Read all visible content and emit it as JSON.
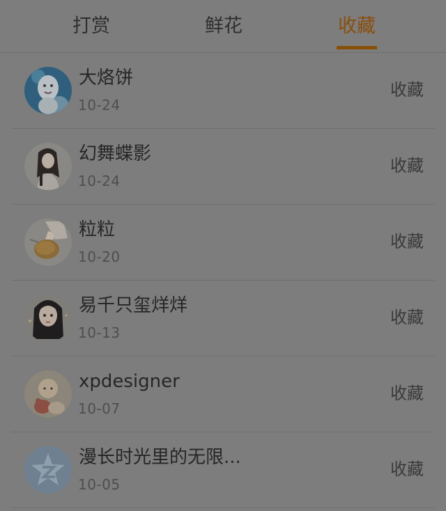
{
  "tabs": [
    {
      "label": "打赏",
      "active": false
    },
    {
      "label": "鲜花",
      "active": false
    },
    {
      "label": "收藏",
      "active": true
    }
  ],
  "colors": {
    "active_tab": "#8a4e0c",
    "overlay_bg": "#7d7d7d"
  },
  "records": [
    {
      "name": "大烙饼",
      "date": "10-24",
      "action": "收藏",
      "avatar_icon": "cartoon-character-avatar"
    },
    {
      "name": "幻舞蝶影",
      "date": "10-24",
      "action": "收藏",
      "avatar_icon": "girl-photo-avatar"
    },
    {
      "name": "粒粒",
      "date": "10-20",
      "action": "收藏",
      "avatar_icon": "bread-photo-avatar"
    },
    {
      "name": "易千只玺烊烊",
      "date": "10-13",
      "action": "收藏",
      "avatar_icon": "anime-girl-avatar"
    },
    {
      "name": "xpdesigner",
      "date": "10-07",
      "action": "收藏",
      "avatar_icon": "baby-photo-avatar"
    },
    {
      "name": "漫长时光里的无限...",
      "date": "10-05",
      "action": "收藏",
      "avatar_icon": "default-qzone-avatar"
    }
  ]
}
